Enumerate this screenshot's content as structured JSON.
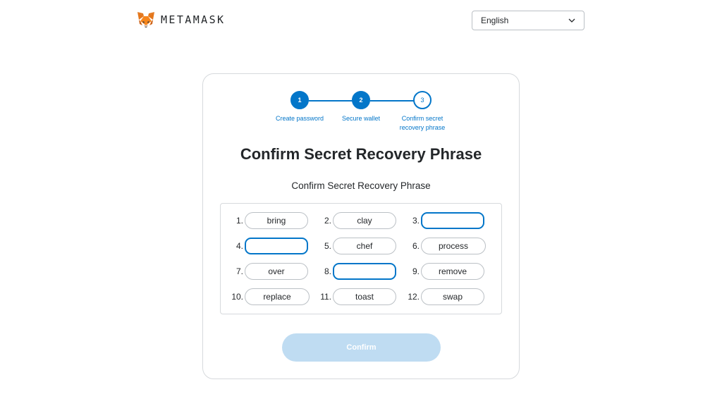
{
  "header": {
    "brand": "METAMASK",
    "logo_icon": "metamask-fox-icon",
    "language": {
      "selected": "English",
      "icon": "chevron-down-icon"
    }
  },
  "stepper": {
    "steps": [
      {
        "number": "1",
        "label": "Create password",
        "state": "complete"
      },
      {
        "number": "2",
        "label": "Secure wallet",
        "state": "complete"
      },
      {
        "number": "3",
        "label": "Confirm secret recovery phrase",
        "state": "current"
      }
    ]
  },
  "main": {
    "title": "Confirm Secret Recovery Phrase",
    "subtitle": "Confirm Secret Recovery Phrase",
    "words": [
      {
        "index": "1.",
        "value": "bring",
        "editable": false
      },
      {
        "index": "2.",
        "value": "clay",
        "editable": false
      },
      {
        "index": "3.",
        "value": "",
        "editable": true
      },
      {
        "index": "4.",
        "value": "",
        "editable": true
      },
      {
        "index": "5.",
        "value": "chef",
        "editable": false
      },
      {
        "index": "6.",
        "value": "process",
        "editable": false
      },
      {
        "index": "7.",
        "value": "over",
        "editable": false
      },
      {
        "index": "8.",
        "value": "",
        "editable": true
      },
      {
        "index": "9.",
        "value": "remove",
        "editable": false
      },
      {
        "index": "10.",
        "value": "replace",
        "editable": false
      },
      {
        "index": "11.",
        "value": "toast",
        "editable": false
      },
      {
        "index": "12.",
        "value": "swap",
        "editable": false
      }
    ],
    "confirm_label": "Confirm",
    "confirm_disabled": true
  },
  "colors": {
    "primary": "#0376c9",
    "primary_disabled": "#bfdcf2",
    "text": "#24272a",
    "border": "#d6d9dc"
  }
}
